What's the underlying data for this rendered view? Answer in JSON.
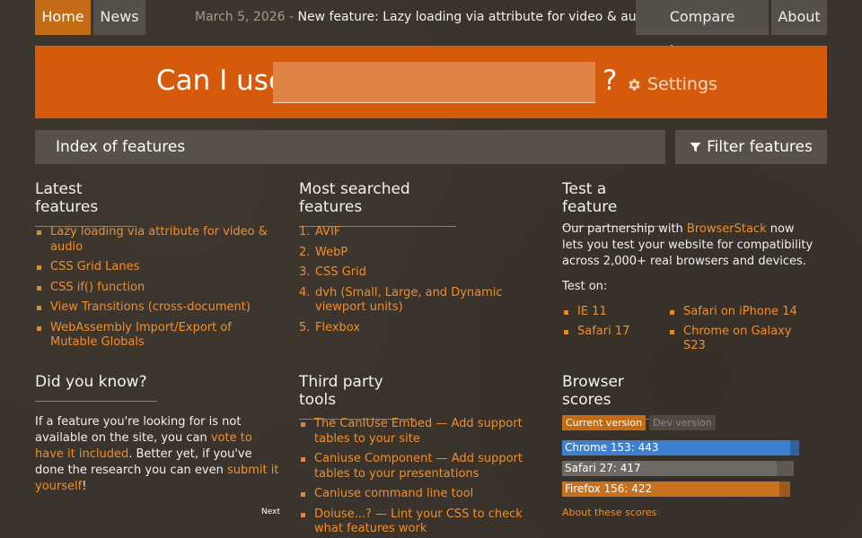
{
  "nav": {
    "home": "Home",
    "news": "News",
    "news_date": "March 5, 2026",
    "news_separator": " - ",
    "news_text": "New feature: Lazy loading via attribute for video & audio",
    "compare": "Compare browsers",
    "about": "About"
  },
  "banner": {
    "label": "Can I use",
    "search_value": "",
    "question": "?",
    "settings": "Settings"
  },
  "index_bar": {
    "title": "Index of features",
    "filter": "Filter features"
  },
  "latest": {
    "title": "Latest features",
    "items": [
      "Lazy loading via attribute for video & audio",
      "CSS Grid Lanes",
      "CSS if() function",
      "View Transitions (cross-document)",
      "WebAssembly Import/Export of Mutable Globals"
    ]
  },
  "most_searched": {
    "title": "Most searched features",
    "items": [
      {
        "n": "1.",
        "label": "AVIF"
      },
      {
        "n": "2.",
        "label": "WebP"
      },
      {
        "n": "3.",
        "label": "CSS Grid"
      },
      {
        "n": "4.",
        "label": "dvh (Small, Large, and Dynamic viewport units)"
      },
      {
        "n": "5.",
        "label": "Flexbox"
      }
    ]
  },
  "test": {
    "title": "Test a feature",
    "intro_pre": "Our partnership with ",
    "intro_link": "BrowserStack",
    "intro_post": " now lets you test your website for compatibility across 2,000+ real browsers and devices.",
    "test_on": "Test on:",
    "items": [
      "IE 11",
      "Safari on iPhone 14",
      "Safari 17",
      "Chrome on Galaxy S23"
    ]
  },
  "did_you_know": {
    "title": "Did you know?",
    "text1": "If a feature you're looking for is not available on the site, you can ",
    "link1": "vote to have it included",
    "text2": ". Better yet, if you've done the research you can even ",
    "link2": "submit it yourself",
    "text3": "!",
    "next": "Next"
  },
  "third_party": {
    "title": "Third party tools",
    "items": [
      "The CanIUse Embed — Add support tables to your site",
      "Caniuse Component — Add support tables to your presentations",
      "Caniuse command line tool",
      "Doiuse...? — Lint your CSS to check what features work"
    ]
  },
  "scores": {
    "title": "Browser scores",
    "tab_current": "Current version",
    "tab_dev": "Dev version",
    "bars": [
      {
        "label": "Chrome 153: 443",
        "value": 443,
        "max": 460,
        "color": "#3d7fd0",
        "track": "#2e62a3"
      },
      {
        "label": "Safari 27: 417",
        "value": 417,
        "max": 450,
        "color": "#6e6964",
        "track": "#5c5852"
      },
      {
        "label": "Firefox 156: 422",
        "value": 422,
        "max": 442,
        "color": "#c7711e",
        "track": "#9c5a1a"
      }
    ],
    "about": "About these scores"
  }
}
